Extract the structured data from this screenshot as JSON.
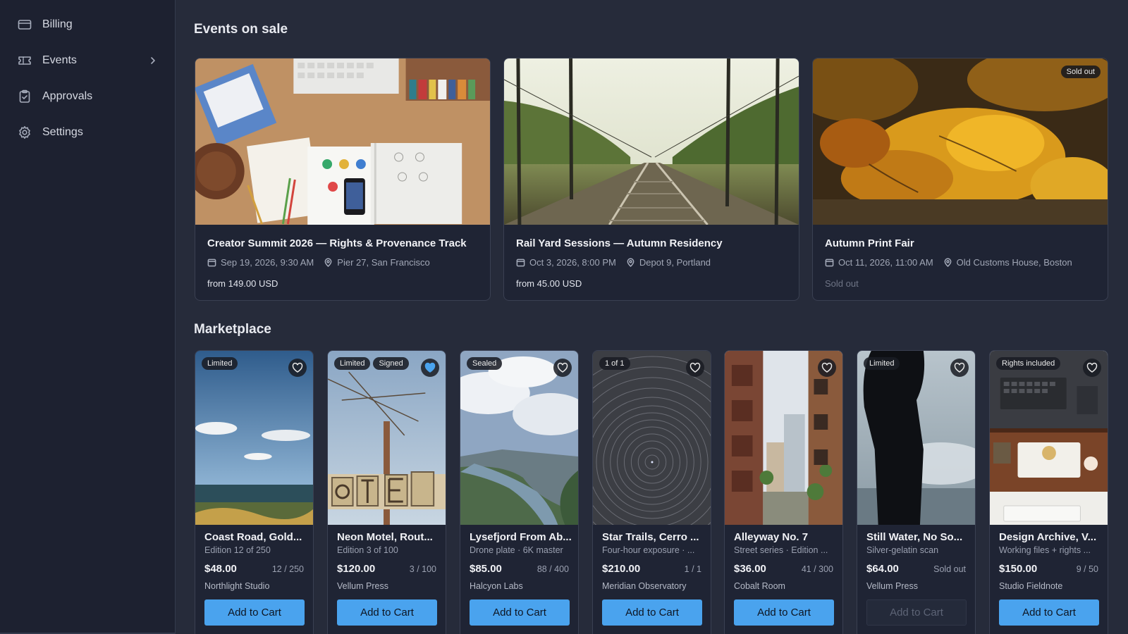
{
  "sidebar": {
    "items": [
      {
        "label": "Billing",
        "icon": "credit-card-icon"
      },
      {
        "label": "Events",
        "icon": "ticket-icon"
      },
      {
        "label": "Approvals",
        "icon": "clipboard-check-icon"
      },
      {
        "label": "Settings",
        "icon": "gear-icon"
      }
    ]
  },
  "events": {
    "title": "Events on sale",
    "cards": [
      {
        "title": "Creator Summit 2026 — Rights & Provenance Track",
        "date": "Sep 19, 2026, 9:30 AM",
        "venue": "Pier 27, San Francisco",
        "price": "from 149.00 USD",
        "image": "desk-workspace-photo"
      },
      {
        "title": "Rail Yard Sessions — Autumn Residency",
        "date": "Oct 3, 2026, 8:00 PM",
        "venue": "Depot 9, Portland",
        "price": "from 45.00 USD",
        "image": "railway-tracks-photo"
      },
      {
        "title": "Autumn Print Fair",
        "date": "Oct 11, 2026, 11:00 AM",
        "venue": "Old Customs House, Boston",
        "price": "Sold out",
        "badge": "Sold out",
        "image": "autumn-leaves-photo"
      }
    ]
  },
  "marketplace": {
    "title": "Marketplace",
    "items": [
      {
        "name": "Coast Road, Gold...",
        "sub": "Edition 12 of 250",
        "price": "$48.00",
        "stock": "12 / 250",
        "seller": "Northlight Studio",
        "badges": [
          "Limited"
        ],
        "cart": "Add to Cart"
      },
      {
        "name": "Neon Motel, Rout...",
        "sub": "Edition 3 of 100",
        "price": "$120.00",
        "stock": "3 / 100",
        "seller": "Vellum Press",
        "badges": [
          "Limited",
          "Signed"
        ],
        "cart": "Add to Cart"
      },
      {
        "name": "Lysefjord From Ab...",
        "sub": "Drone plate · 6K master",
        "price": "$85.00",
        "stock": "88 / 400",
        "seller": "Halcyon Labs",
        "badges": [
          "Sealed"
        ],
        "cart": "Add to Cart"
      },
      {
        "name": "Star Trails, Cerro ...",
        "sub": "Four-hour exposure · ...",
        "price": "$210.00",
        "stock": "1 / 1",
        "seller": "Meridian Observatory",
        "badges": [
          "1 of 1"
        ],
        "cart": "Add to Cart"
      },
      {
        "name": "Alleyway No. 7",
        "sub": "Street series · Edition ...",
        "price": "$36.00",
        "stock": "41 / 300",
        "seller": "Cobalt Room",
        "badges": [],
        "cart": "Add to Cart"
      },
      {
        "name": "Still Water, No So...",
        "sub": "Silver-gelatin scan",
        "price": "$64.00",
        "stock": "Sold out",
        "seller": "Vellum Press",
        "badges": [
          "Limited"
        ],
        "cart": "Add to Cart"
      },
      {
        "name": "Design Archive, V...",
        "sub": "Working files + rights ...",
        "price": "$150.00",
        "stock": "9 / 50",
        "seller": "Studio Fieldnote",
        "badges": [
          "Rights included"
        ],
        "cart": "Add to Cart"
      }
    ]
  },
  "colors": {
    "accent": "#4aa3ee",
    "background": "#262b3a",
    "sidebar": "#1d2130"
  }
}
